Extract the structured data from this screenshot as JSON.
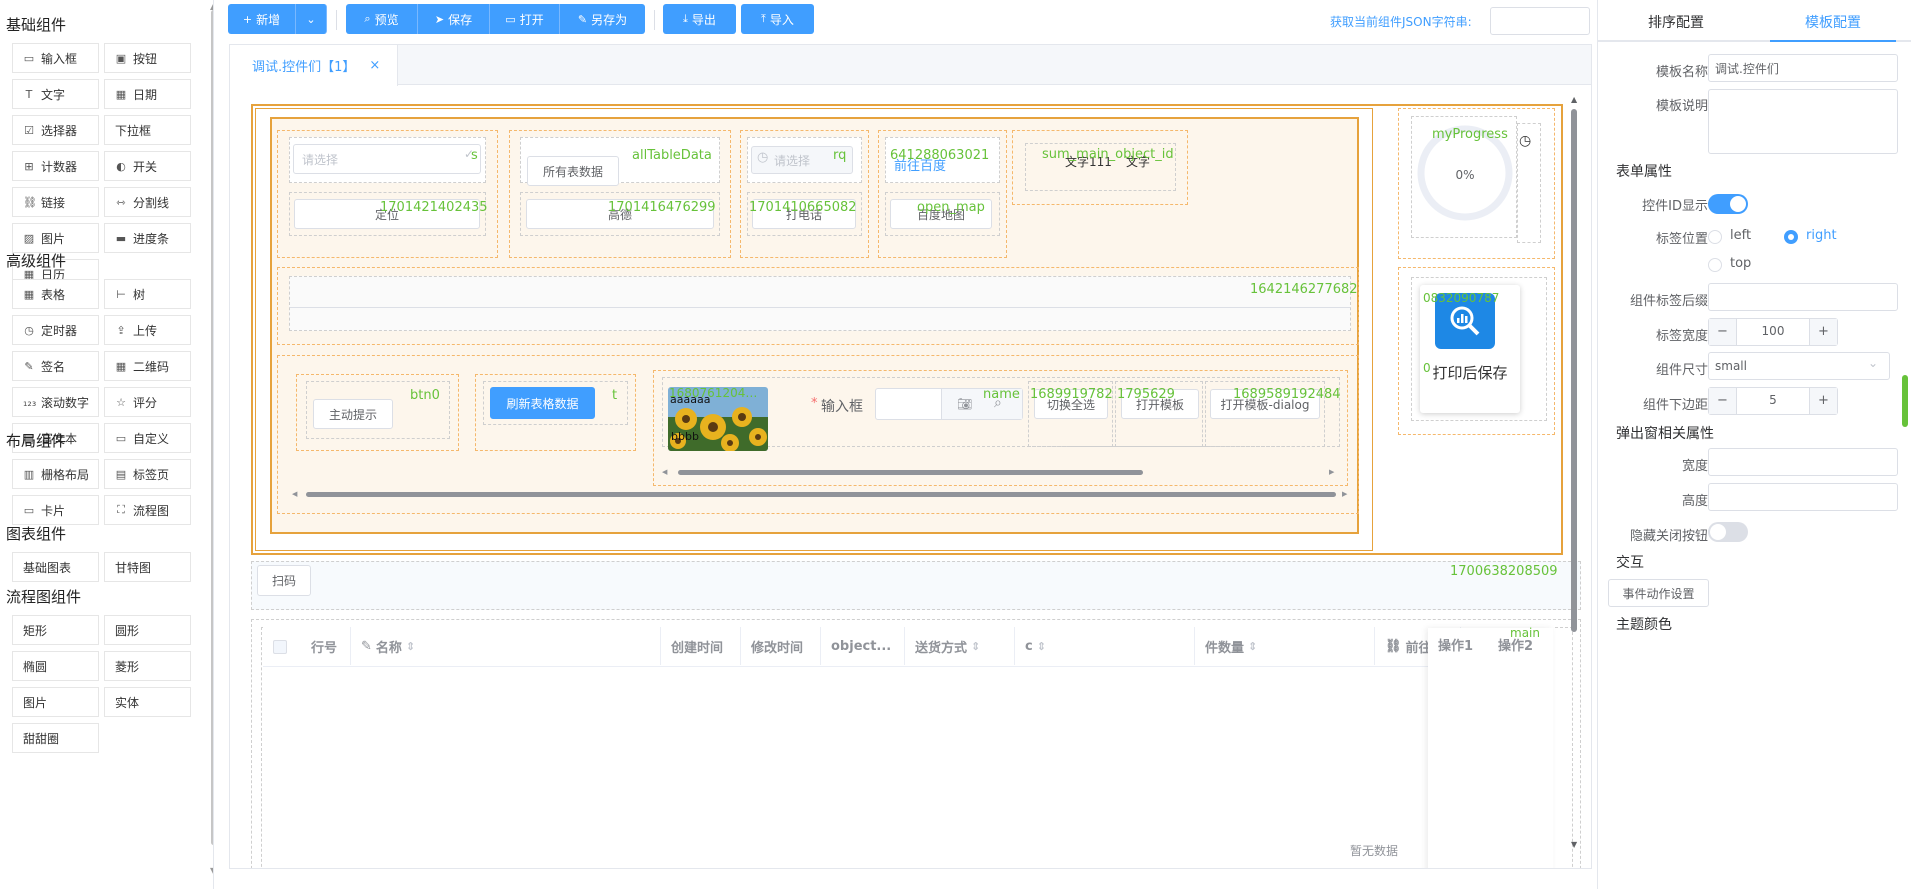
{
  "left_panel": {
    "groups": [
      {
        "title": "基础组件",
        "items": [
          {
            "label": "输入框",
            "icon": "input-icon"
          },
          {
            "label": "按钮",
            "icon": "button-icon"
          },
          {
            "label": "文字",
            "icon": "text-icon"
          },
          {
            "label": "日期",
            "icon": "date-icon"
          },
          {
            "label": "选择器",
            "icon": "select-icon"
          },
          {
            "label": "下拉框",
            "icon": ""
          },
          {
            "label": "计数器",
            "icon": "counter-icon"
          },
          {
            "label": "开关",
            "icon": "switch-icon"
          },
          {
            "label": "链接",
            "icon": "link-icon"
          },
          {
            "label": "分割线",
            "icon": "divider-icon"
          },
          {
            "label": "图片",
            "icon": "image-icon"
          },
          {
            "label": "进度条",
            "icon": "progress-icon"
          },
          {
            "label": "日历",
            "icon": "calendar-icon"
          }
        ]
      },
      {
        "title": "高级组件",
        "items": [
          {
            "label": "表格",
            "icon": "table-icon"
          },
          {
            "label": "树",
            "icon": "tree-icon"
          },
          {
            "label": "定时器",
            "icon": "timer-icon"
          },
          {
            "label": "上传",
            "icon": "upload-icon"
          },
          {
            "label": "签名",
            "icon": "signature-icon"
          },
          {
            "label": "二维码",
            "icon": "qrcode-icon"
          },
          {
            "label": "滚动数字",
            "icon": "number-icon"
          },
          {
            "label": "评分",
            "icon": "star-icon"
          },
          {
            "label": "富文本",
            "icon": "richtext-icon"
          },
          {
            "label": "自定义",
            "icon": "custom-icon"
          }
        ]
      },
      {
        "title": "布局组件",
        "items": [
          {
            "label": "栅格布局",
            "icon": "grid-icon"
          },
          {
            "label": "标签页",
            "icon": "tabs-icon"
          },
          {
            "label": "卡片",
            "icon": "card-icon"
          },
          {
            "label": "流程图",
            "icon": "flow-icon"
          }
        ]
      },
      {
        "title": "图表组件",
        "items": [
          {
            "label": "基础图表",
            "icon": ""
          },
          {
            "label": "甘特图",
            "icon": ""
          }
        ]
      },
      {
        "title": "流程图组件",
        "items": [
          {
            "label": "矩形",
            "icon": ""
          },
          {
            "label": "圆形",
            "icon": ""
          },
          {
            "label": "椭圆",
            "icon": ""
          },
          {
            "label": "菱形",
            "icon": ""
          },
          {
            "label": "图片",
            "icon": ""
          },
          {
            "label": "实体",
            "icon": ""
          },
          {
            "label": "甜甜圈",
            "icon": ""
          }
        ]
      }
    ]
  },
  "toolbar": {
    "new_label": "新增",
    "preview_label": "预览",
    "save_label": "保存",
    "open_label": "打开",
    "save_as_label": "另存为",
    "export_label": "导出",
    "import_label": "导入",
    "json_link": "获取当前组件JSON字符串:",
    "json_value": ""
  },
  "tab": {
    "label": "调试.控件们【1】",
    "close": "×"
  },
  "canvas": {
    "select_placeholder": "请选择",
    "id_s": "s",
    "id_1701421402435": "1701421402435",
    "btn_locate": "定位",
    "btn_all_table": "所有表数据",
    "id_allTableData": "allTableData",
    "id_1701416476299": "1701416476299",
    "btn_gaode": "高德",
    "date_placeholder": "请选择",
    "id_rq": "rq",
    "id_1701410665082": "1701410665082",
    "btn_call": "打电话",
    "id_641288063021": "641288063021",
    "link_baidu": "前往百度",
    "id_open_map": "open_map",
    "btn_baidu_map": "百度地图",
    "id_sum_main": "sum_main_object_id",
    "text_1": "文字111",
    "text_2": "文字",
    "id_myProgress": "myProgress",
    "progress_value": "0%",
    "id_1642146277682": "1642146277682",
    "id_btn0": "btn0",
    "btn_active_tip": "主动提示",
    "btn_refresh": "刷新表格数据",
    "id_t": "t",
    "id_1680761204": "1680761204…",
    "img_caption_1": "aaaaaa",
    "img_caption_2": "bbbb",
    "input_label_required": "*",
    "input_label": "输入框",
    "id_name": "name",
    "id_1689919": "1689919782",
    "btn_switch_all": "切换全选",
    "id_1795": "1795629",
    "btn_open_tpl": "打开模板",
    "id_1689589": "1689589192484",
    "btn_open_tpl_dialog": "打开模板-dialog",
    "id_0832": "0832090787",
    "id_0": "0",
    "btn_print_save": "打印后保存",
    "btn_scan": "扫码",
    "id_1700638208509": "1700638208509",
    "id_main": "main",
    "table_empty": "暂无数据",
    "table_headers": [
      "行号",
      "名称",
      "创建时间",
      "修改时间",
      "object...",
      "送货方式",
      "c",
      "件数量",
      "前往",
      "操作1",
      "操作2"
    ]
  },
  "right_panel": {
    "tab_sort": "排序配置",
    "tab_template": "模板配置",
    "tpl_name_label": "模板名称",
    "tpl_name_value": "调试.控件们",
    "tpl_desc_label": "模板说明",
    "tpl_desc_value": "",
    "form_props": "表单属性",
    "show_id_label": "控件ID显示",
    "label_pos_label": "标签位置",
    "pos_left": "left",
    "pos_right": "right",
    "pos_top": "top",
    "label_suffix_label": "组件标签后缀",
    "label_suffix_value": "",
    "label_width_label": "标签宽度",
    "label_width_value": "100",
    "comp_size_label": "组件尺寸",
    "comp_size_value": "small",
    "margin_label": "组件下边距",
    "margin_value": "5",
    "popup_props": "弹出窗相关属性",
    "width_label": "宽度",
    "width_value": "",
    "height_label": "高度",
    "height_value": "",
    "hide_close_label": "隐藏关闭按钮",
    "interaction": "交互",
    "event_btn": "事件动作设置",
    "theme_color": "主题颜色"
  },
  "colors": {
    "primary": "#409eff",
    "id_green": "#67c23a",
    "orange_border": "#e6a23c"
  }
}
